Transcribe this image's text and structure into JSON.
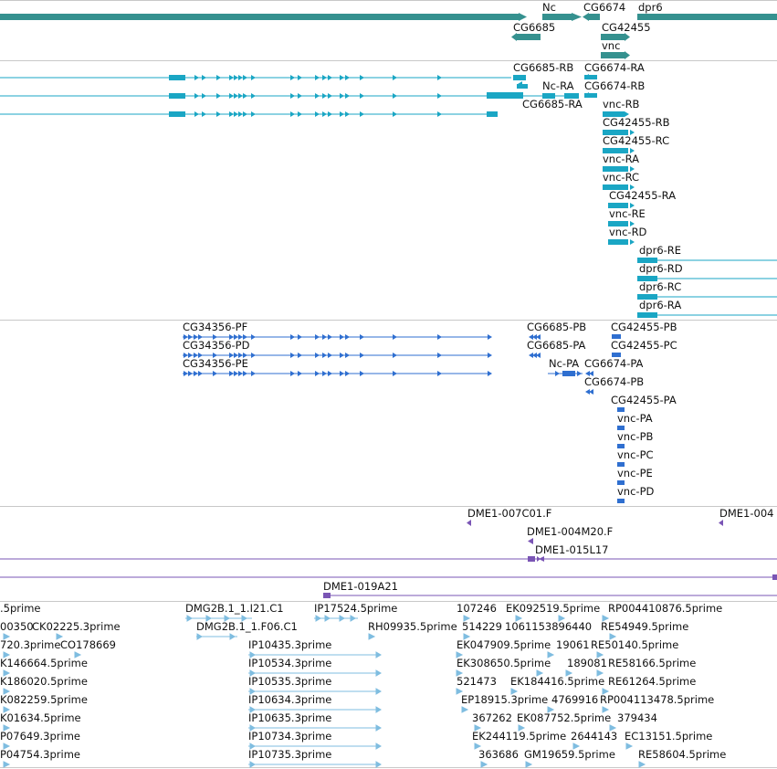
{
  "colors": {
    "gene": "#35918f",
    "transcript": "#1aa6c4",
    "cds": "#2f6fd0",
    "clone": "#7a55b5",
    "est": "#7fbde0",
    "separator": "#c8c8c8"
  },
  "tracks": {
    "genes": {
      "labels": [
        "Nc",
        "CG6674",
        "dpr6",
        "CG6685",
        "CG42455",
        "vnc"
      ]
    },
    "transcripts": {
      "labels": [
        "CG6685-RB",
        "CG6674-RA",
        "Nc-RA",
        "CG6674-RB",
        "CG6685-RA",
        "vnc-RB",
        "CG42455-RB",
        "CG42455-RC",
        "vnc-RA",
        "vnc-RC",
        "CG42455-RA",
        "vnc-RE",
        "vnc-RD",
        "dpr6-RE",
        "dpr6-RD",
        "dpr6-RC",
        "dpr6-RA"
      ]
    },
    "cds": {
      "labels": [
        "CG34356-PF",
        "CG34356-PD",
        "CG34356-PE",
        "CG6685-PB",
        "CG42455-PB",
        "CG6685-PA",
        "CG42455-PC",
        "Nc-PA",
        "CG6674-PA",
        "CG6674-PB",
        "CG42455-PA",
        "vnc-PA",
        "vnc-PB",
        "vnc-PC",
        "vnc-PE",
        "vnc-PD"
      ]
    },
    "clones": {
      "labels": [
        "DME1-007C01.F",
        "DME1-004",
        "DME1-004M20.F",
        "DME1-015L17",
        "DME1-019A21"
      ]
    },
    "ests": {
      "labels": [
        ".5prime",
        "DMG2B.1_1.I21.C1",
        "IP17524.5prime",
        "107246",
        "EK092519.5prime",
        "RP004410876.5prime",
        "00350",
        "CK02225.3prime",
        "DMG2B.1_1.F06.C1",
        "RH09935.5prime",
        "514229",
        "1061153896440",
        "RE54949.5prime",
        "720.3prime",
        "CO178669",
        "IP10435.3prime",
        "EK047909.5prime",
        "19061",
        "RE50140.5prime",
        "K146664.5prime",
        "IP10534.3prime",
        "EK308650.5prime",
        "189081",
        "RE58166.5prime",
        "K186020.5prime",
        "IP10535.3prime",
        "521473",
        "EK184416.5prime",
        "RE61264.5prime",
        "K082259.5prime",
        "IP10634.3prime",
        "EP18915.3prime",
        "4769916",
        "RP004113478.5prime",
        "K01634.5prime",
        "IP10635.3prime",
        "367262",
        "EK087752.5prime",
        "379434",
        "P07649.3prime",
        "IP10734.3prime",
        "EK244119.5prime",
        "2644143",
        "EC13151.5prime",
        "P04754.3prime",
        "IP10735.3prime",
        "363686",
        "GM19659.5prime",
        "RE58604.5prime"
      ]
    }
  }
}
